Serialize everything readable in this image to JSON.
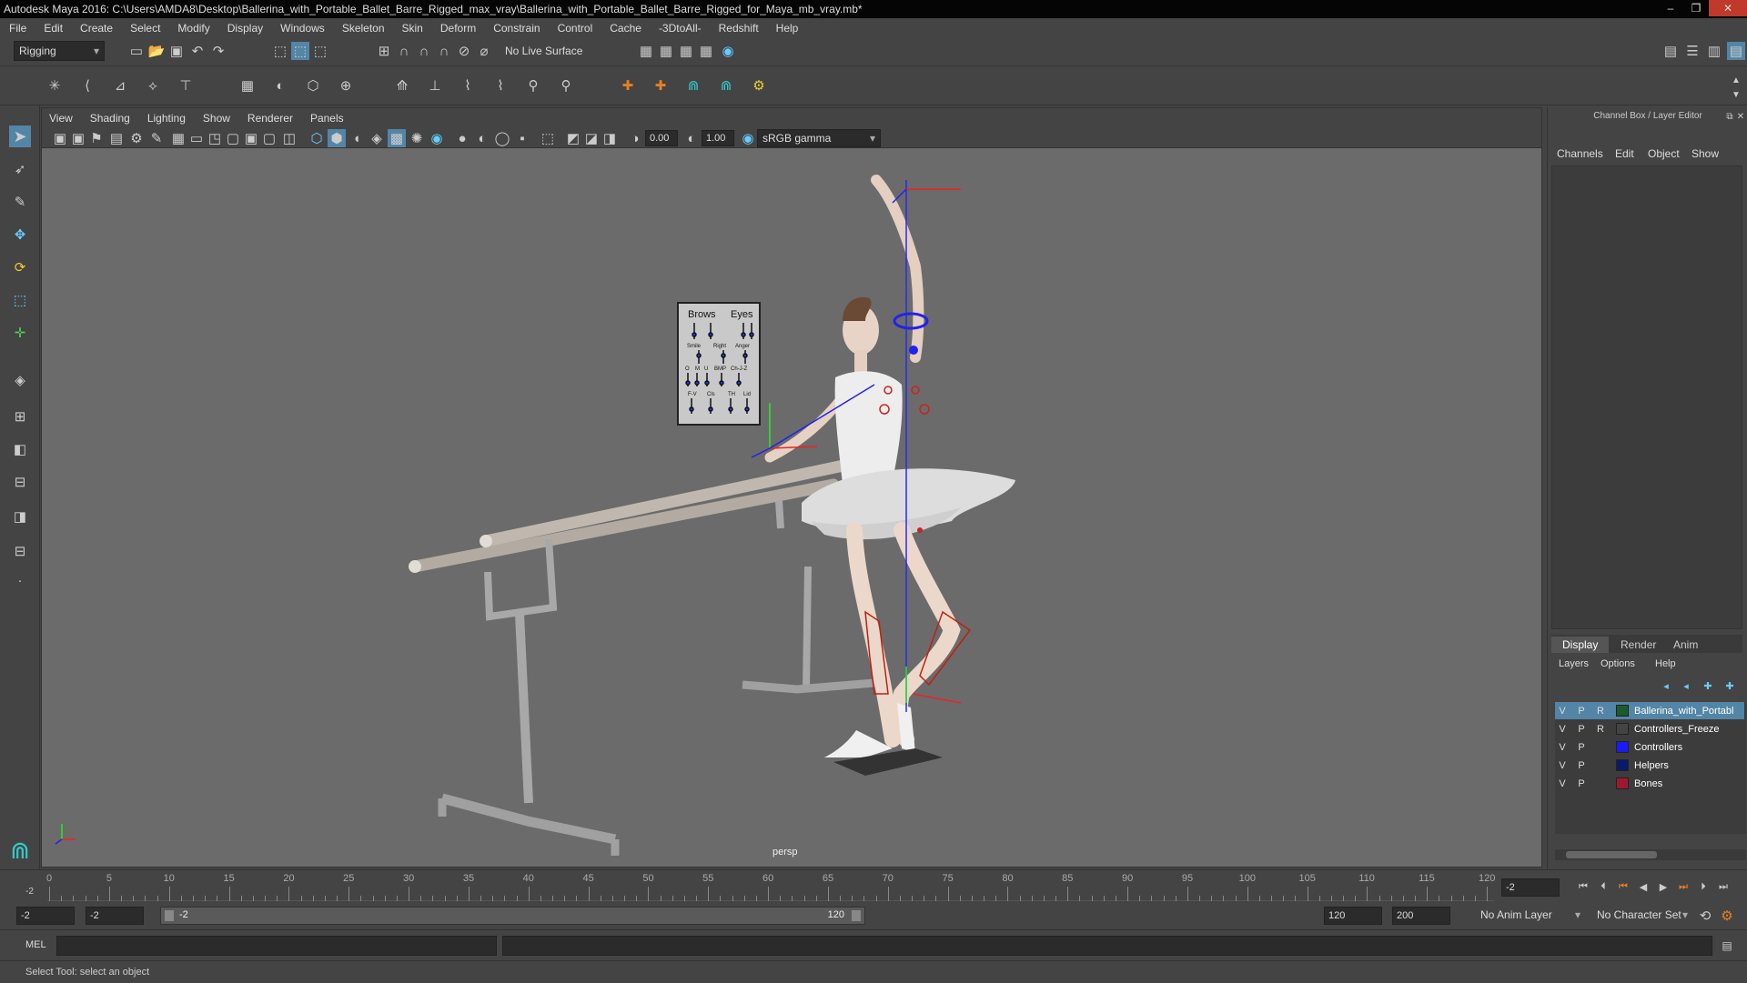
{
  "window": {
    "title": "Autodesk Maya 2016: C:\\Users\\AMDA8\\Desktop\\Ballerina_with_Portable_Ballet_Barre_Rigged_max_vray\\Ballerina_with_Portable_Ballet_Barre_Rigged_for_Maya_mb_vray.mb*"
  },
  "menu": [
    "File",
    "Edit",
    "Create",
    "Select",
    "Modify",
    "Display",
    "Windows",
    "Skeleton",
    "Skin",
    "Deform",
    "Constrain",
    "Control",
    "Cache",
    "-3DtoAll-",
    "Redshift",
    "Help"
  ],
  "status_line": {
    "menu_set": "Rigging",
    "live_surface": "No Live Surface"
  },
  "viewport": {
    "menu": [
      "View",
      "Shading",
      "Lighting",
      "Show",
      "Renderer",
      "Panels"
    ],
    "exposure": "0.00",
    "gamma": "1.00",
    "color_space": "sRGB gamma",
    "camera": "persp"
  },
  "face_panel": {
    "brows": "Brows",
    "eyes": "Eyes",
    "row2": [
      "Smile",
      "Right",
      "Anger"
    ],
    "row3": [
      "O",
      "M",
      "U",
      "BMP",
      "Ch-J-Z"
    ],
    "row4": [
      "F-V",
      "Cls",
      "TH",
      "Lid"
    ]
  },
  "channel_box": {
    "header": "Channel Box / Layer Editor",
    "tabs": [
      "Channels",
      "Edit",
      "Object",
      "Show"
    ]
  },
  "layer_editor": {
    "tabs": [
      "Display",
      "Render",
      "Anim"
    ],
    "active_tab": "Display",
    "menu": [
      "Layers",
      "Options",
      "Help"
    ],
    "layers": [
      {
        "v": "V",
        "p": "P",
        "r": "R",
        "name": "Ballerina_with_Portabl",
        "color": "#1d5a2c",
        "selected": true
      },
      {
        "v": "V",
        "p": "P",
        "r": "R",
        "name": "Controllers_Freeze",
        "color": "#444444",
        "selected": false
      },
      {
        "v": "V",
        "p": "P",
        "r": "",
        "name": "Controllers",
        "color": "#1a1aff",
        "selected": false
      },
      {
        "v": "V",
        "p": "P",
        "r": "",
        "name": "Helpers",
        "color": "#0a1a6a",
        "selected": false
      },
      {
        "v": "V",
        "p": "P",
        "r": "",
        "name": "Bones",
        "color": "#a01830",
        "selected": false
      }
    ]
  },
  "timeline": {
    "ticks": [
      "0",
      "5",
      "10",
      "15",
      "20",
      "25",
      "30",
      "35",
      "40",
      "45",
      "50",
      "55",
      "60",
      "65",
      "70",
      "75",
      "80",
      "85",
      "90",
      "95",
      "100",
      "105",
      "110",
      "115",
      "120"
    ],
    "start_marker": "-2",
    "current_frame": "-2"
  },
  "range": {
    "start": "-2",
    "playback_start": "-2",
    "slider_start": "-2",
    "slider_end": "120",
    "playback_end": "120",
    "end": "200",
    "anim_layer": "No Anim Layer",
    "character_set": "No Character Set"
  },
  "command_line": {
    "lang": "MEL"
  },
  "help_line": "Select Tool: select an object"
}
